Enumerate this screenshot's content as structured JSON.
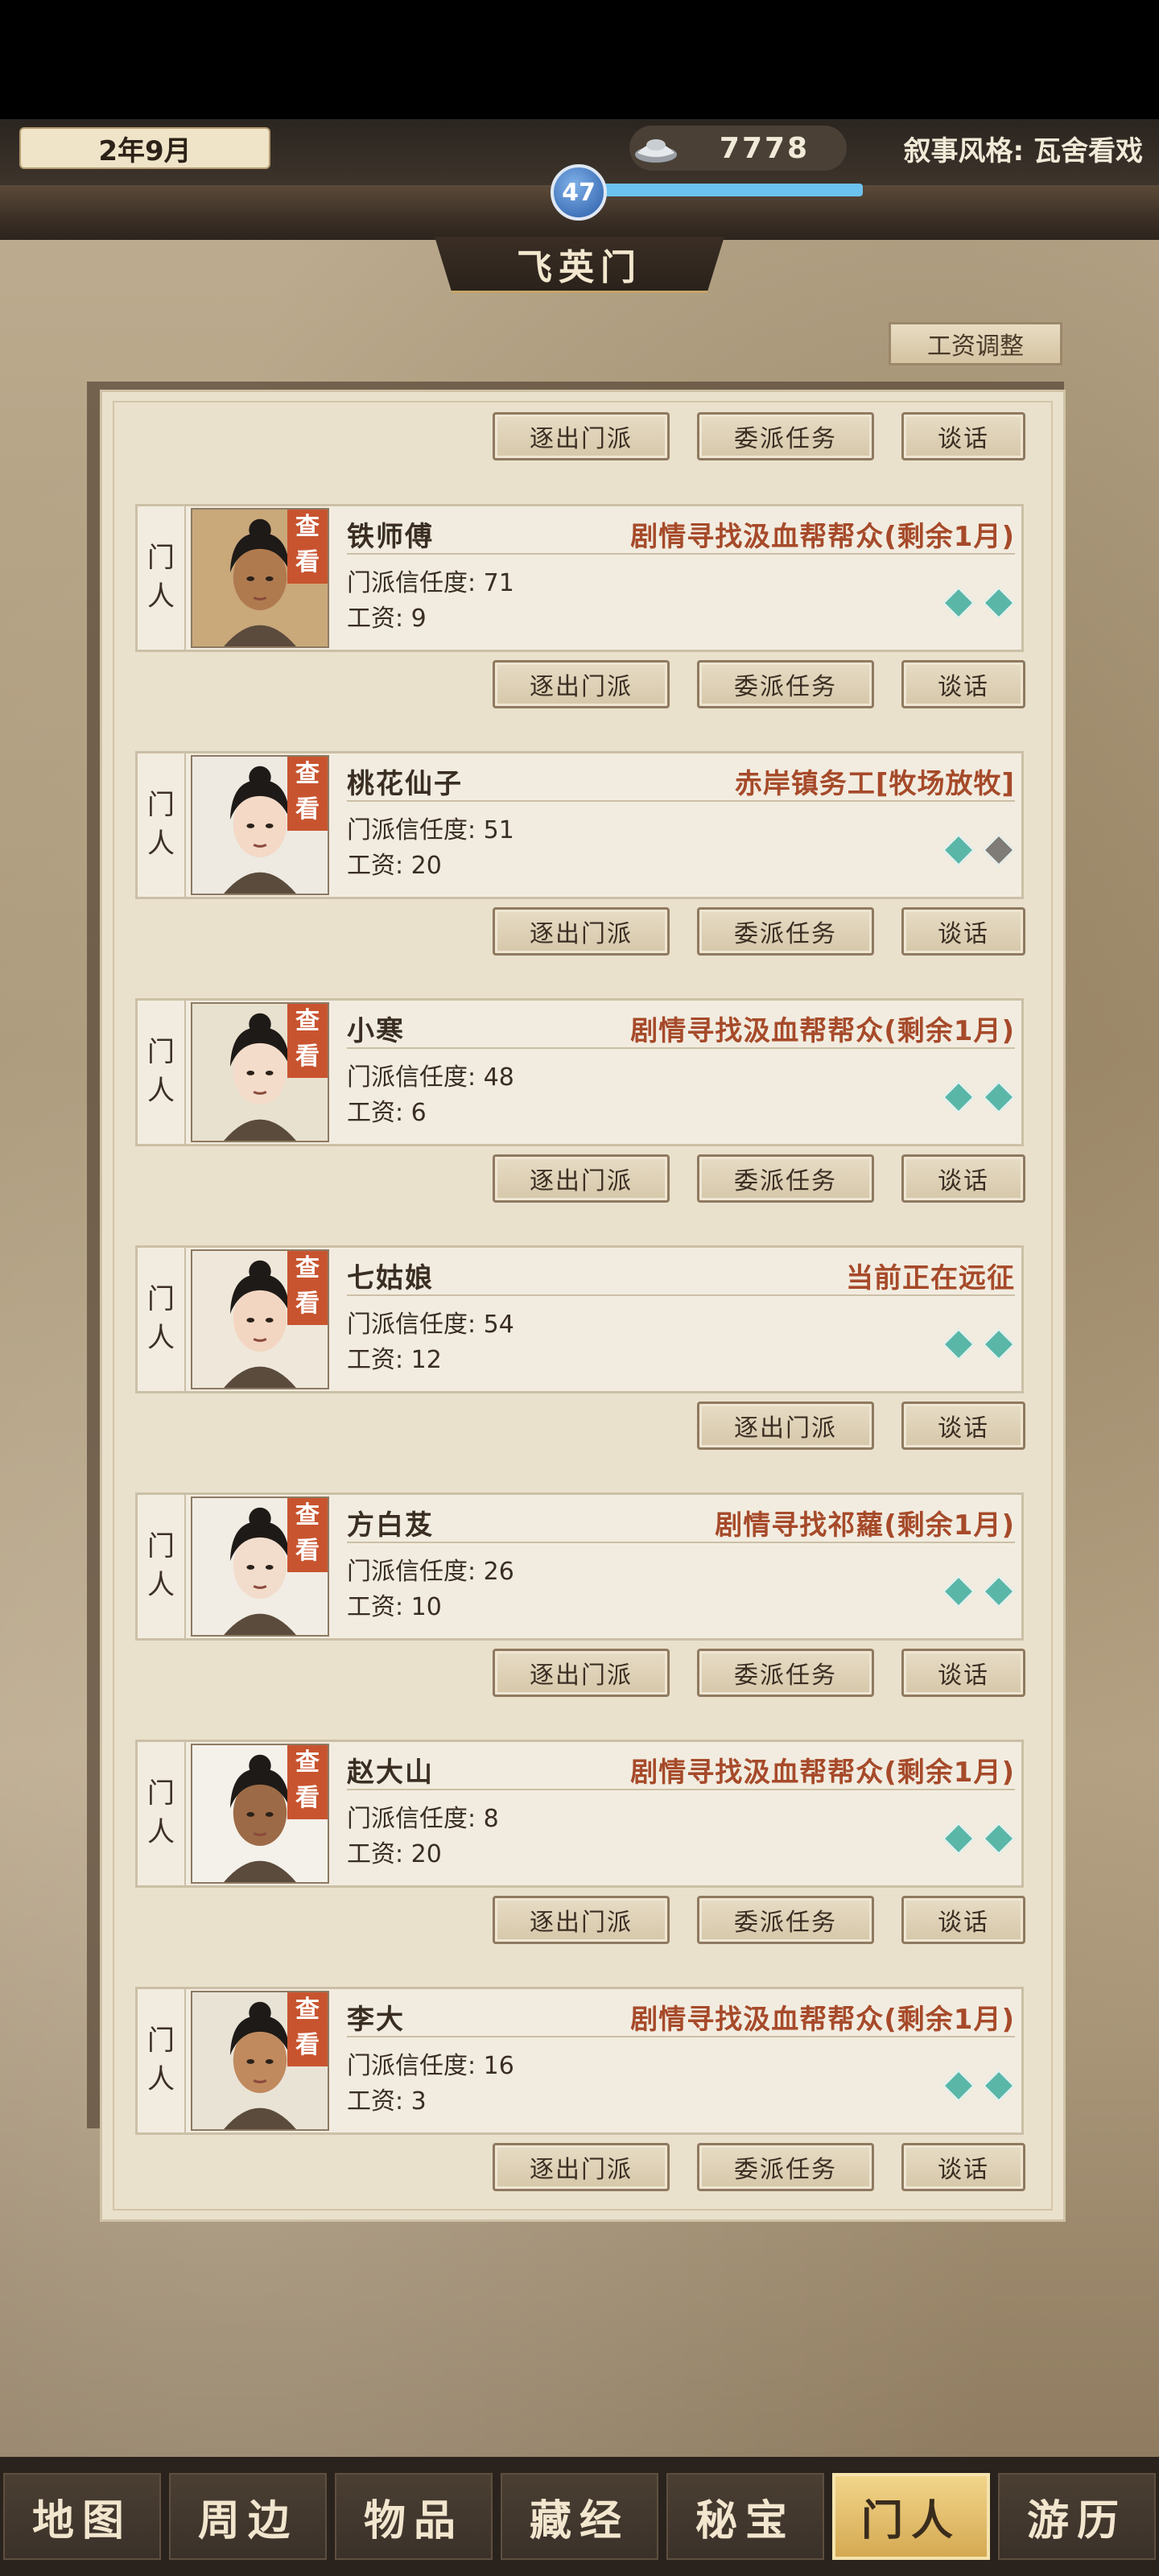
{
  "header": {
    "date": "2年9月",
    "silver_amount": "7778",
    "narrative_style": "叙事风格: 瓦舍看戏",
    "level": "47",
    "level_progress": 1.0,
    "sect_name": "飞英门",
    "wage_adjust_label": "工资调整"
  },
  "actions": {
    "expel": "逐出门派",
    "task": "委派任务",
    "talk": "谈话"
  },
  "card_tag": [
    "门",
    "人"
  ],
  "view_label": [
    "查",
    "看"
  ],
  "trust_prefix": "门派信任度: ",
  "wage_prefix": "工资: ",
  "members": [
    {
      "name": "铁师傅",
      "status": "剧情寻找汲血帮帮众(剩余1月)",
      "trust": "71",
      "wage": "9",
      "gems": [
        "teal",
        "teal"
      ],
      "can_task": true
    },
    {
      "name": "桃花仙子",
      "status": "赤岸镇务工[牧场放牧]",
      "trust": "51",
      "wage": "20",
      "gems": [
        "teal",
        "gray"
      ],
      "can_task": true
    },
    {
      "name": "小寒",
      "status": "剧情寻找汲血帮帮众(剩余1月)",
      "trust": "48",
      "wage": "6",
      "gems": [
        "teal",
        "teal"
      ],
      "can_task": true
    },
    {
      "name": "七姑娘",
      "status": "当前正在远征",
      "trust": "54",
      "wage": "12",
      "gems": [
        "teal",
        "teal"
      ],
      "can_task": false
    },
    {
      "name": "方白芨",
      "status": "剧情寻找祁蘿(剩余1月)",
      "trust": "26",
      "wage": "10",
      "gems": [
        "teal",
        "teal"
      ],
      "can_task": true
    },
    {
      "name": "赵大山",
      "status": "剧情寻找汲血帮帮众(剩余1月)",
      "trust": "8",
      "wage": "20",
      "gems": [
        "teal",
        "teal"
      ],
      "can_task": true
    },
    {
      "name": "李大",
      "status": "剧情寻找汲血帮帮众(剩余1月)",
      "trust": "16",
      "wage": "3",
      "gems": [
        "teal",
        "teal"
      ],
      "can_task": true
    }
  ],
  "nav": {
    "tabs": [
      "地图",
      "周边",
      "物品",
      "藏经",
      "秘宝",
      "门人",
      "游历"
    ],
    "active": "门人"
  },
  "colors": {
    "status_red": "#a64a2a",
    "view_badge": "#c8542f",
    "gem_teal": "#5ab7a8",
    "gem_gray": "#7f7b76",
    "nav_active": "#e3bf6c",
    "xp_bar": "#6cc2ee"
  }
}
